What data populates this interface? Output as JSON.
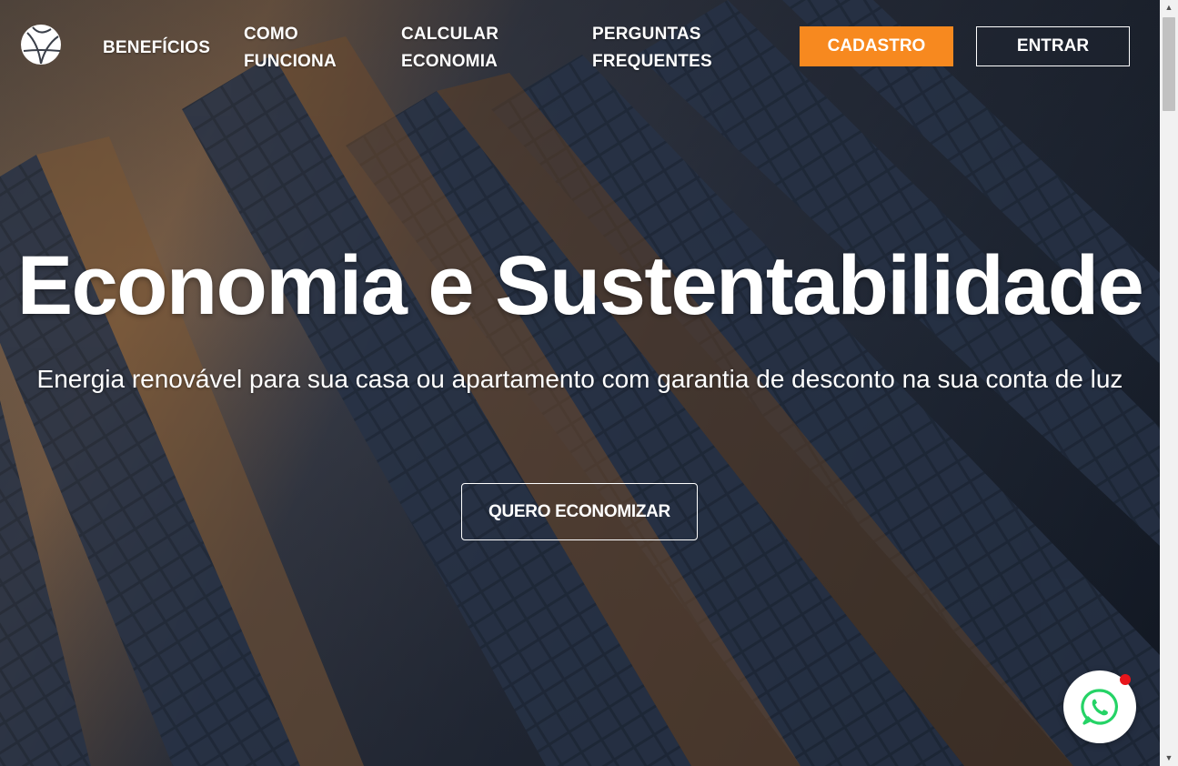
{
  "nav": {
    "beneficios": "BENEFÍCIOS",
    "como_line1": "COMO",
    "como_line2": "FUNCIONA",
    "calcular_line1": "CALCULAR",
    "calcular_line2": "ECONOMIA",
    "perguntas_line1": "PERGUNTAS",
    "perguntas_line2": "FREQUENTES",
    "cadastro": "CADASTRO",
    "entrar": "ENTRAR"
  },
  "hero": {
    "title": "Economia e Sustentabilidade",
    "subtitle": "Energia renovável para sua casa ou apartamento com garantia de desconto na sua conta de luz",
    "cta": "QUERO ECONOMIZAR"
  },
  "icons": {
    "logo": "globe-leaf-logo-icon",
    "whatsapp": "whatsapp-icon",
    "scroll_up": "triangle-up-icon",
    "scroll_down": "triangle-down-icon"
  },
  "colors": {
    "accent": "#f7891f",
    "badge": "#e8151b",
    "whatsapp_green": "#25d366"
  }
}
